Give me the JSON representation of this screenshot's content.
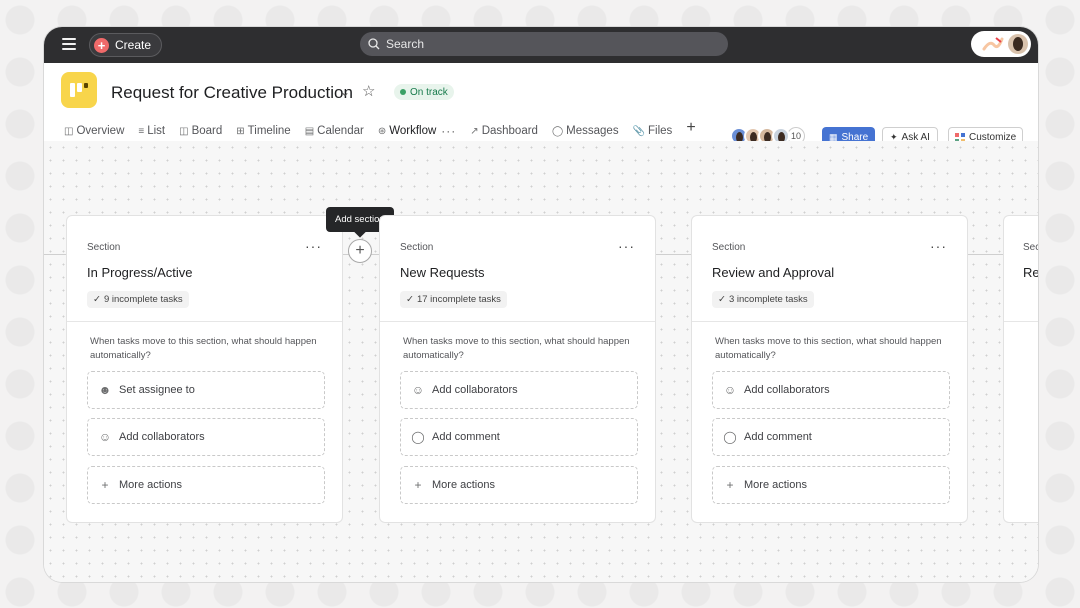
{
  "topbar": {
    "create_label": "Create",
    "search_placeholder": "Search"
  },
  "header": {
    "project_title": "Request for Creative Production",
    "status": "On track",
    "member_count": "10",
    "share_label": "Share",
    "askai_label": "Ask AI",
    "customize_label": "Customize"
  },
  "tabs": [
    {
      "label": "Overview",
      "icon": "overview-icon"
    },
    {
      "label": "List",
      "icon": "list-icon"
    },
    {
      "label": "Board",
      "icon": "board-icon"
    },
    {
      "label": "Timeline",
      "icon": "timeline-icon"
    },
    {
      "label": "Calendar",
      "icon": "calendar-icon"
    },
    {
      "label": "Workflow",
      "icon": "workflow-icon",
      "active": true
    },
    {
      "label": "Dashboard",
      "icon": "dashboard-icon"
    },
    {
      "label": "Messages",
      "icon": "messages-icon"
    },
    {
      "label": "Files",
      "icon": "files-icon"
    }
  ],
  "tooltip": "Add section",
  "sections": [
    {
      "label": "Section",
      "title": "In Progress/Active",
      "badge": "9 incomplete tasks",
      "prompt": "When tasks move to this section, what should happen automatically?",
      "actions": [
        {
          "label": "Set assignee to",
          "icon": "person-icon"
        },
        {
          "label": "Add collaborators",
          "icon": "people-icon"
        },
        {
          "label": "More actions",
          "icon": "plus-icon"
        }
      ]
    },
    {
      "label": "Section",
      "title": "New Requests",
      "badge": "17 incomplete tasks",
      "prompt": "When tasks move to this section, what should happen automatically?",
      "actions": [
        {
          "label": "Add collaborators",
          "icon": "people-icon"
        },
        {
          "label": "Add comment",
          "icon": "comment-icon"
        },
        {
          "label": "More actions",
          "icon": "plus-icon"
        }
      ]
    },
    {
      "label": "Section",
      "title": "Review and Approval",
      "badge": "3 incomplete tasks",
      "prompt": "When tasks move to this section, what should happen automatically?",
      "actions": [
        {
          "label": "Add collaborators",
          "icon": "people-icon"
        },
        {
          "label": "Add comment",
          "icon": "comment-icon"
        },
        {
          "label": "More actions",
          "icon": "plus-icon"
        }
      ]
    }
  ],
  "partial_section": {
    "label": "Sec",
    "title": "Re"
  }
}
